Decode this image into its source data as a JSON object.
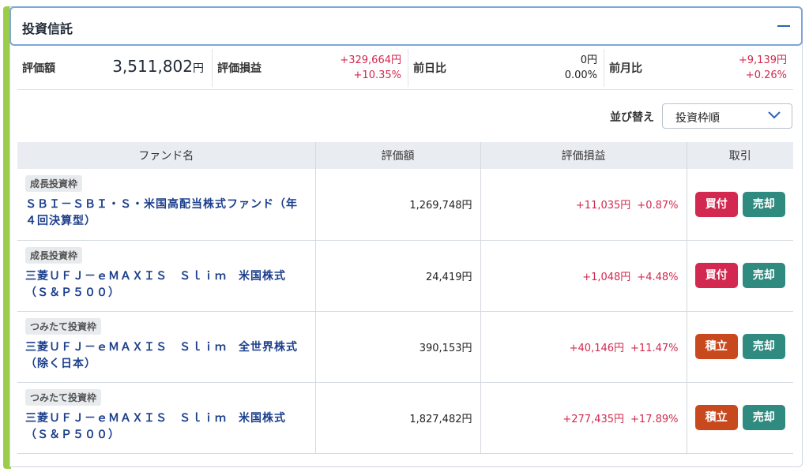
{
  "header": {
    "title": "投資信託"
  },
  "summary": {
    "valuation_label": "評価額",
    "valuation_value": "3,511,802",
    "valuation_unit": "円",
    "pl_label": "評価損益",
    "pl_amount": "+329,664円",
    "pl_pct": "+10.35%",
    "day_label": "前日比",
    "day_amount": "0円",
    "day_pct": "0.00%",
    "month_label": "前月比",
    "month_amount": "+9,139円",
    "month_pct": "+0.26%"
  },
  "sort": {
    "label": "並び替え",
    "selected": "投資枠順"
  },
  "table": {
    "headers": [
      "ファンド名",
      "評価額",
      "評価損益",
      "取引"
    ],
    "rows": [
      {
        "badge": "成長投資枠",
        "name": "ＳＢＩ－ＳＢＩ・Ｓ・米国高配当株式ファンド（年４回決算型）",
        "value": "1,269,748円",
        "pl_amount": "+11,035円",
        "pl_pct": "+0.87%",
        "action1": "買付",
        "action2": "売却"
      },
      {
        "badge": "成長投資枠",
        "name": "三菱ＵＦＪ－ｅＭＡＸＩＳ　Ｓｌｉｍ　米国株式（Ｓ＆Ｐ５００）",
        "value": "24,419円",
        "pl_amount": "+1,048円",
        "pl_pct": "+4.48%",
        "action1": "買付",
        "action2": "売却"
      },
      {
        "badge": "つみたて投資枠",
        "name": "三菱ＵＦＪ－ｅＭＡＸＩＳ　Ｓｌｉｍ　全世界株式（除く日本）",
        "value": "390,153円",
        "pl_amount": "+40,146円",
        "pl_pct": "+11.47%",
        "action1": "積立",
        "action2": "売却"
      },
      {
        "badge": "つみたて投資枠",
        "name": "三菱ＵＦＪ－ｅＭＡＸＩＳ　Ｓｌｉｍ　米国株式（Ｓ＆Ｐ５００）",
        "value": "1,827,482円",
        "pl_amount": "+277,435円",
        "pl_pct": "+17.89%",
        "action1": "積立",
        "action2": "売却"
      }
    ]
  },
  "colors": {
    "accent_green": "#9ccd4a",
    "buy": "#d3284f",
    "sell": "#2f8a80",
    "tsumitate": "#c9491f",
    "positive": "#d3284f",
    "fund_link": "#1c3f8c"
  },
  "icons": {
    "collapse": "minus-icon",
    "dropdown": "chevron-down-icon"
  }
}
